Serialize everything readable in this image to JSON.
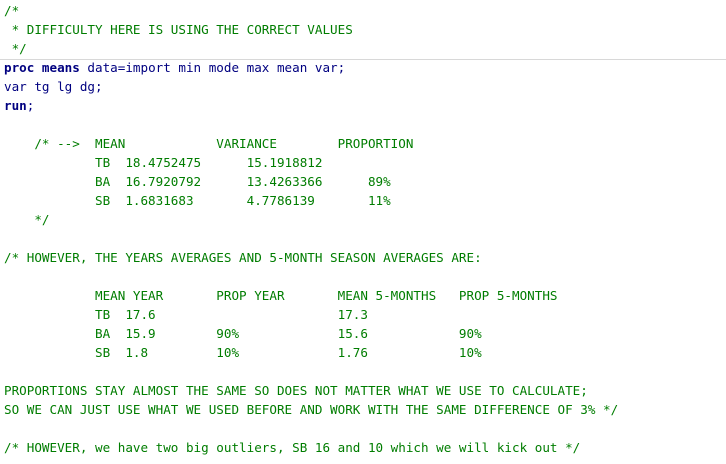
{
  "editor": {
    "colors": {
      "comment": "#007d00",
      "code": "#000080",
      "keyword": "#000080"
    },
    "lines": [
      {
        "text": "/*",
        "kind": "comment"
      },
      {
        "text": " * DIFFICULTY HERE IS USING THE CORRECT VALUES",
        "kind": "comment"
      },
      {
        "text": " */",
        "kind": "comment"
      },
      {
        "kw": "proc means",
        "text": " data=import min mode max mean var;",
        "kind": "code"
      },
      {
        "text": "var tg lg dg;",
        "kind": "code"
      },
      {
        "kw": "run",
        "text": ";",
        "kind": "code"
      },
      {
        "text": "",
        "kind": "blank"
      },
      {
        "text": "    /* -->  MEAN            VARIANCE        PROPORTION",
        "kind": "comment"
      },
      {
        "text": "            TB  18.4752475      15.1918812",
        "kind": "comment"
      },
      {
        "text": "            BA  16.7920792      13.4263366      89%",
        "kind": "comment"
      },
      {
        "text": "            SB  1.6831683       4.7786139       11%",
        "kind": "comment"
      },
      {
        "text": "    */",
        "kind": "comment"
      },
      {
        "text": "",
        "kind": "blank"
      },
      {
        "text": "/* HOWEVER, THE YEARS AVERAGES AND 5-MONTH SEASON AVERAGES ARE:",
        "kind": "comment"
      },
      {
        "text": "",
        "kind": "blank"
      },
      {
        "text": "            MEAN YEAR       PROP YEAR       MEAN 5-MONTHS   PROP 5-MONTHS",
        "kind": "comment"
      },
      {
        "text": "            TB  17.6                        17.3",
        "kind": "comment"
      },
      {
        "text": "            BA  15.9        90%             15.6            90%",
        "kind": "comment"
      },
      {
        "text": "            SB  1.8         10%             1.76            10%",
        "kind": "comment"
      },
      {
        "text": "",
        "kind": "blank"
      },
      {
        "text": "PROPORTIONS STAY ALMOST THE SAME SO DOES NOT MATTER WHAT WE USE TO CALCULATE;",
        "kind": "comment"
      },
      {
        "text": "SO WE CAN JUST USE WHAT WE USED BEFORE AND WORK WITH THE SAME DIFFERENCE OF 3% */",
        "kind": "comment"
      },
      {
        "text": "",
        "kind": "blank"
      },
      {
        "text": "/* HOWEVER, we have two big outliers, SB 16 and 10 which we will kick out */",
        "kind": "comment"
      }
    ]
  }
}
